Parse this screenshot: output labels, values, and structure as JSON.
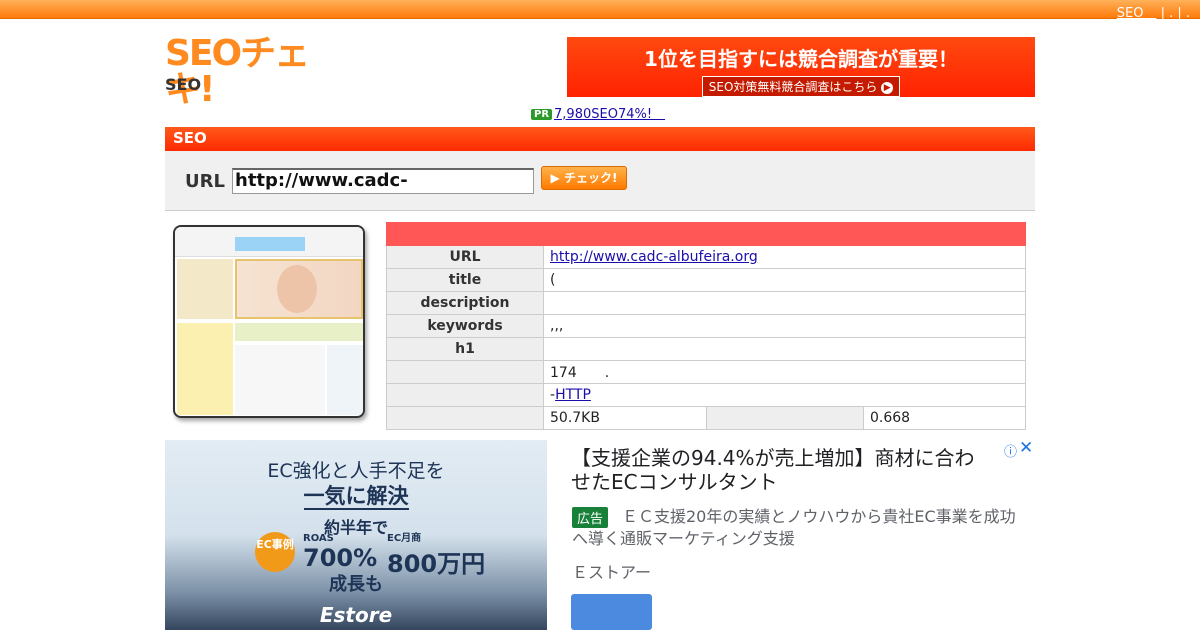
{
  "topnav": {
    "link_label": "SEO　",
    "separators": " | . | ."
  },
  "header": {
    "logo_text": "SEOチェキ!",
    "subtitle": "SEO"
  },
  "banner": {
    "headline": "1位を目指すには競合調査が重要！",
    "button_label": "SEO対策無料競合調査はこちら"
  },
  "pr": {
    "badge": "PR",
    "link_text": "7,980SEO74%!　"
  },
  "section": {
    "title": "SEO"
  },
  "form": {
    "url_label": "URL",
    "url_value": "http://www.cadc-albufeira.org",
    "check_label": "チェック!"
  },
  "results": {
    "rows": [
      {
        "label": "URL",
        "value": "http://www.cadc-albufeira.org"
      },
      {
        "label": "title",
        "value": "("
      },
      {
        "label": "description",
        "value": ""
      },
      {
        "label": "keywords",
        "value": ",,,"
      },
      {
        "label": "h1",
        "value": ""
      },
      {
        "label": "",
        "value": "174　　."
      },
      {
        "label": "",
        "value_prefix": "-",
        "value_link": "HTTP"
      }
    ],
    "size_value": "50.7KB",
    "time_value": "0.668"
  },
  "ad": {
    "image_line1": "EC強化と人手不足を",
    "image_line2": "一気に解決",
    "image_line3": "約半年で",
    "circle_text": "EC事例",
    "roas_label": "ROAS",
    "roas_value": "700%",
    "ec_label": "EC月商",
    "ec_value": "800万円",
    "image_line5": "成長も",
    "brand": "Estore",
    "title": "【支援企業の94.4%が売上増加】商材に合わせたECコンサルタント",
    "badge": "広告",
    "description": "ＥＣ支援20年の実績とノウハウから貴社EC事業を成功へ導く通販マーケティング支援",
    "source": "Ｅストアー",
    "info_icon": "ⓘ",
    "close_icon": "✕"
  }
}
